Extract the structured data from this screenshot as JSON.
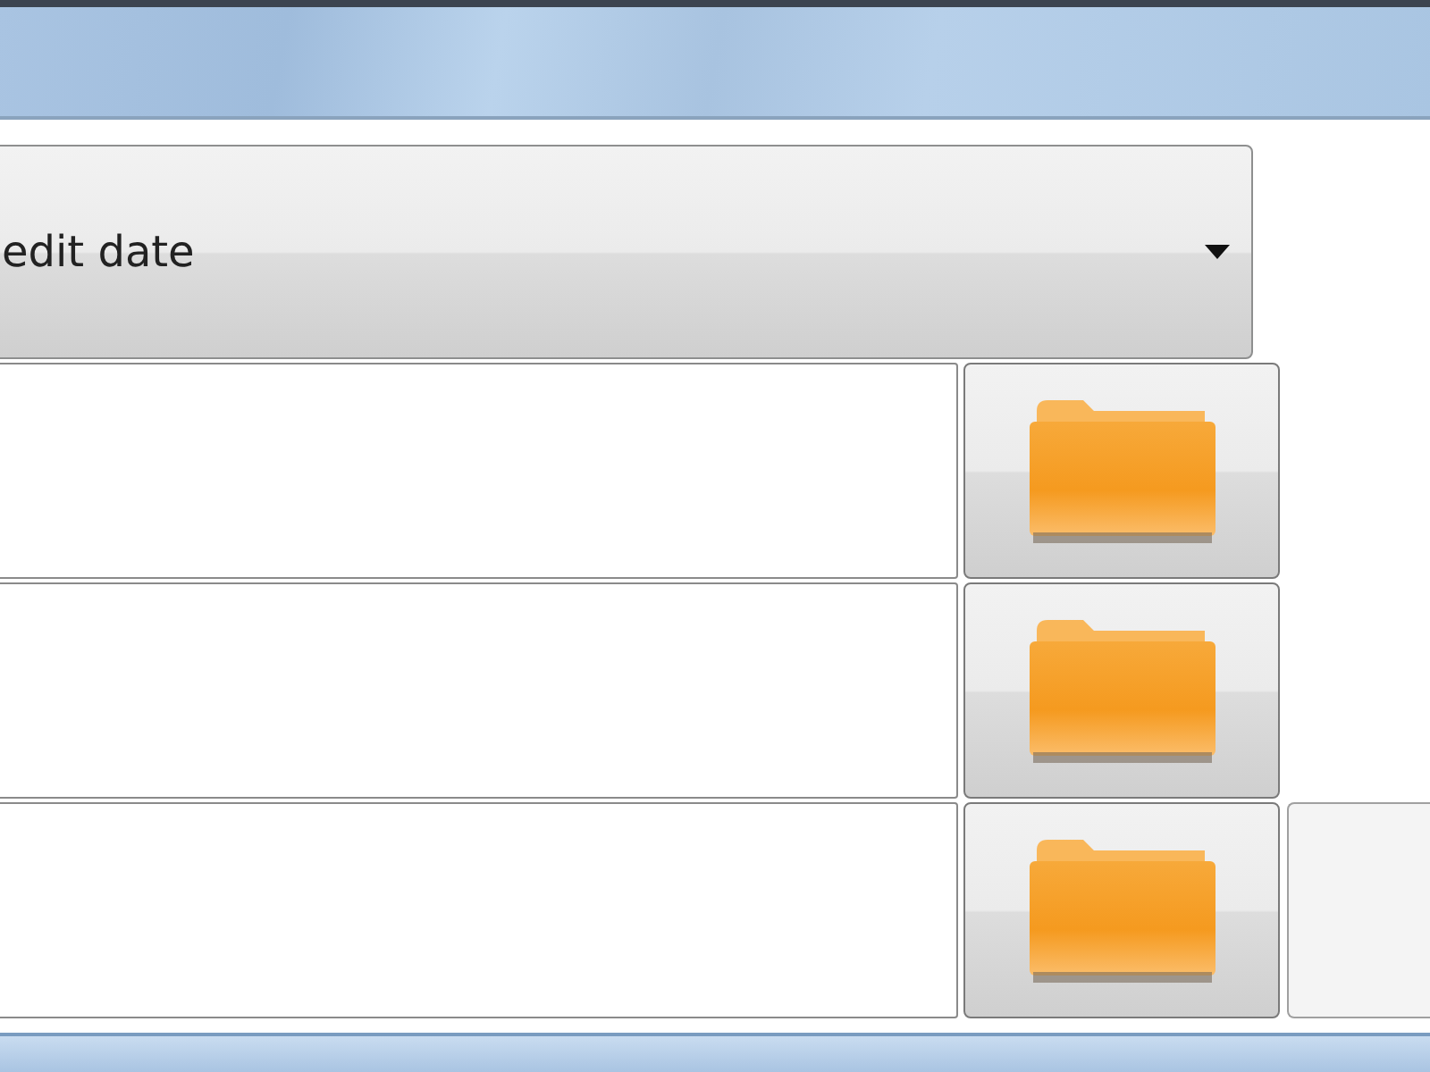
{
  "dropdown": {
    "value": "edit date"
  },
  "path_rows": [
    {
      "extra_button": false
    },
    {
      "extra_button": false
    },
    {
      "extra_button": true
    }
  ]
}
